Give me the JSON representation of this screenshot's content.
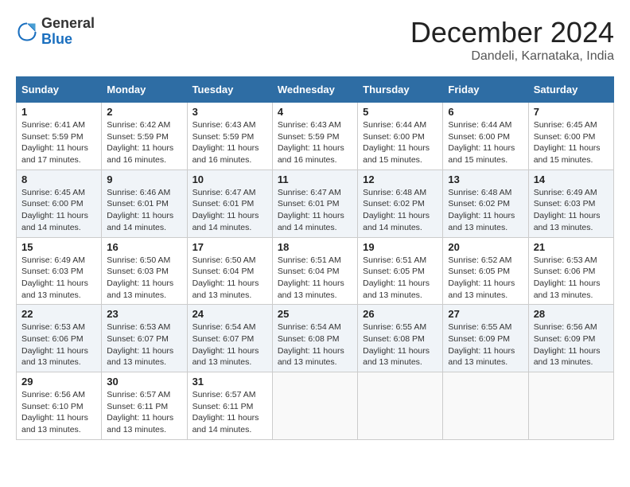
{
  "logo": {
    "general": "General",
    "blue": "Blue"
  },
  "title": "December 2024",
  "location": "Dandeli, Karnataka, India",
  "days_of_week": [
    "Sunday",
    "Monday",
    "Tuesday",
    "Wednesday",
    "Thursday",
    "Friday",
    "Saturday"
  ],
  "weeks": [
    [
      {
        "day": "1",
        "sunrise": "6:41 AM",
        "sunset": "5:59 PM",
        "daylight": "11 hours and 17 minutes."
      },
      {
        "day": "2",
        "sunrise": "6:42 AM",
        "sunset": "5:59 PM",
        "daylight": "11 hours and 16 minutes."
      },
      {
        "day": "3",
        "sunrise": "6:43 AM",
        "sunset": "5:59 PM",
        "daylight": "11 hours and 16 minutes."
      },
      {
        "day": "4",
        "sunrise": "6:43 AM",
        "sunset": "5:59 PM",
        "daylight": "11 hours and 16 minutes."
      },
      {
        "day": "5",
        "sunrise": "6:44 AM",
        "sunset": "6:00 PM",
        "daylight": "11 hours and 15 minutes."
      },
      {
        "day": "6",
        "sunrise": "6:44 AM",
        "sunset": "6:00 PM",
        "daylight": "11 hours and 15 minutes."
      },
      {
        "day": "7",
        "sunrise": "6:45 AM",
        "sunset": "6:00 PM",
        "daylight": "11 hours and 15 minutes."
      }
    ],
    [
      {
        "day": "8",
        "sunrise": "6:45 AM",
        "sunset": "6:00 PM",
        "daylight": "11 hours and 14 minutes."
      },
      {
        "day": "9",
        "sunrise": "6:46 AM",
        "sunset": "6:01 PM",
        "daylight": "11 hours and 14 minutes."
      },
      {
        "day": "10",
        "sunrise": "6:47 AM",
        "sunset": "6:01 PM",
        "daylight": "11 hours and 14 minutes."
      },
      {
        "day": "11",
        "sunrise": "6:47 AM",
        "sunset": "6:01 PM",
        "daylight": "11 hours and 14 minutes."
      },
      {
        "day": "12",
        "sunrise": "6:48 AM",
        "sunset": "6:02 PM",
        "daylight": "11 hours and 14 minutes."
      },
      {
        "day": "13",
        "sunrise": "6:48 AM",
        "sunset": "6:02 PM",
        "daylight": "11 hours and 13 minutes."
      },
      {
        "day": "14",
        "sunrise": "6:49 AM",
        "sunset": "6:03 PM",
        "daylight": "11 hours and 13 minutes."
      }
    ],
    [
      {
        "day": "15",
        "sunrise": "6:49 AM",
        "sunset": "6:03 PM",
        "daylight": "11 hours and 13 minutes."
      },
      {
        "day": "16",
        "sunrise": "6:50 AM",
        "sunset": "6:03 PM",
        "daylight": "11 hours and 13 minutes."
      },
      {
        "day": "17",
        "sunrise": "6:50 AM",
        "sunset": "6:04 PM",
        "daylight": "11 hours and 13 minutes."
      },
      {
        "day": "18",
        "sunrise": "6:51 AM",
        "sunset": "6:04 PM",
        "daylight": "11 hours and 13 minutes."
      },
      {
        "day": "19",
        "sunrise": "6:51 AM",
        "sunset": "6:05 PM",
        "daylight": "11 hours and 13 minutes."
      },
      {
        "day": "20",
        "sunrise": "6:52 AM",
        "sunset": "6:05 PM",
        "daylight": "11 hours and 13 minutes."
      },
      {
        "day": "21",
        "sunrise": "6:53 AM",
        "sunset": "6:06 PM",
        "daylight": "11 hours and 13 minutes."
      }
    ],
    [
      {
        "day": "22",
        "sunrise": "6:53 AM",
        "sunset": "6:06 PM",
        "daylight": "11 hours and 13 minutes."
      },
      {
        "day": "23",
        "sunrise": "6:53 AM",
        "sunset": "6:07 PM",
        "daylight": "11 hours and 13 minutes."
      },
      {
        "day": "24",
        "sunrise": "6:54 AM",
        "sunset": "6:07 PM",
        "daylight": "11 hours and 13 minutes."
      },
      {
        "day": "25",
        "sunrise": "6:54 AM",
        "sunset": "6:08 PM",
        "daylight": "11 hours and 13 minutes."
      },
      {
        "day": "26",
        "sunrise": "6:55 AM",
        "sunset": "6:08 PM",
        "daylight": "11 hours and 13 minutes."
      },
      {
        "day": "27",
        "sunrise": "6:55 AM",
        "sunset": "6:09 PM",
        "daylight": "11 hours and 13 minutes."
      },
      {
        "day": "28",
        "sunrise": "6:56 AM",
        "sunset": "6:09 PM",
        "daylight": "11 hours and 13 minutes."
      }
    ],
    [
      {
        "day": "29",
        "sunrise": "6:56 AM",
        "sunset": "6:10 PM",
        "daylight": "11 hours and 13 minutes."
      },
      {
        "day": "30",
        "sunrise": "6:57 AM",
        "sunset": "6:11 PM",
        "daylight": "11 hours and 13 minutes."
      },
      {
        "day": "31",
        "sunrise": "6:57 AM",
        "sunset": "6:11 PM",
        "daylight": "11 hours and 14 minutes."
      },
      null,
      null,
      null,
      null
    ]
  ]
}
